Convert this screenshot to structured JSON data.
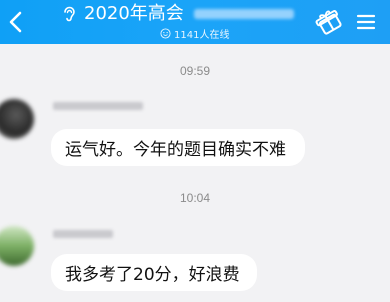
{
  "header": {
    "back_icon": "chevron-left-icon",
    "ear_icon": "ear-icon",
    "title": "2020年高会",
    "online_text": "1141人在线",
    "online_icon": "smiley-icon",
    "gift_icon": "gift-icon",
    "menu_icon": "hamburger-menu-icon",
    "accent_color": "#1ba4f8"
  },
  "messages": [
    {
      "timestamp": "09:59",
      "text": "运气好。今年的题目确实不难"
    },
    {
      "timestamp": "10:04",
      "text": "我多考了20分，好浪费"
    }
  ]
}
